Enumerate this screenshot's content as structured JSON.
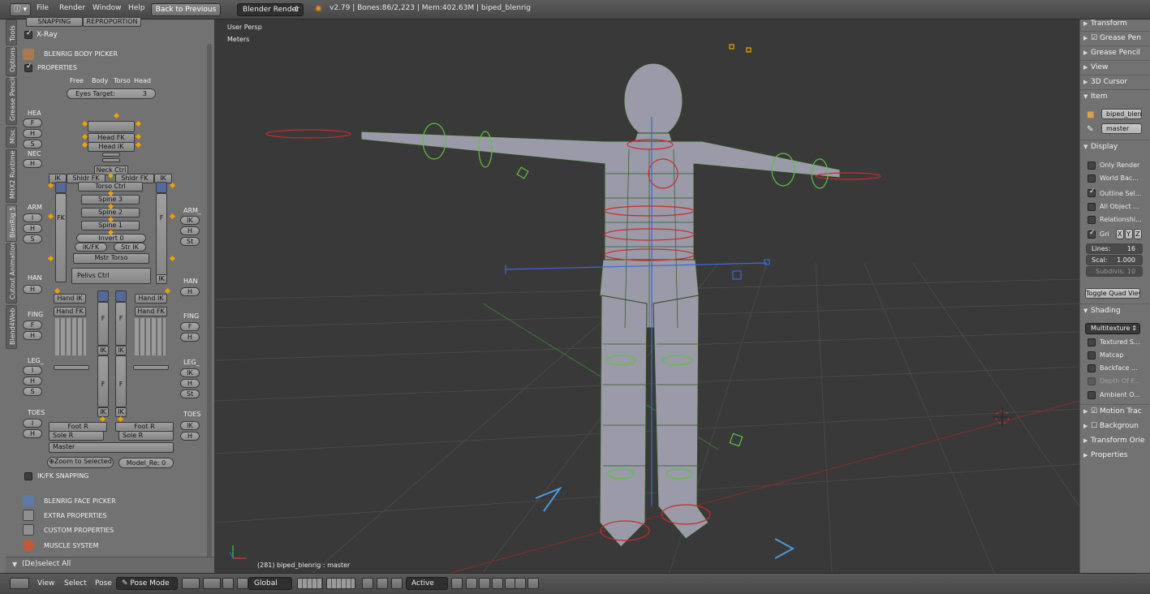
{
  "topbar": {
    "menus": [
      "File",
      "Render",
      "Window",
      "Help"
    ],
    "back_button": "Back to Previous",
    "engine": "Blender Render",
    "status": "v2.79 | Bones:86/2,223 | Mem:402.63M | biped_blenrig"
  },
  "left_tabs": [
    "Tools",
    "Options",
    "Grease Pencil",
    "Misc",
    "MHX2 Runtime",
    "BlenRig 5",
    "Cutout Animation",
    "Blend4Web"
  ],
  "tool_panel": {
    "snapping": "SNAPPING",
    "reproportion": "REPROPORTION",
    "xray": "X-Ray",
    "body_picker": "BLENRIG BODY PICKER",
    "properties": "PROPERTIES",
    "mode_labels": [
      "Free",
      "Body",
      "Torso",
      "Head"
    ],
    "eyes_target_label": "Eyes Target:",
    "eyes_target_value": "3",
    "head_label": "HEA",
    "neck_label": "NEC",
    "arm_l": "ARM",
    "arm_r": "ARM_",
    "hand_l": "HAN",
    "hand_r": "HAN",
    "fing_l": "FING",
    "fing_r": "FING",
    "leg_l": "LEG_",
    "leg_r": "LEG_",
    "toes_l": "TOES",
    "toes_r": "TOES",
    "fhs": [
      "F",
      "H",
      "S"
    ],
    "ih s": "",
    "head_fk": "Head FK",
    "head_ik": "Head IK",
    "neck_ctrl": "Neck Ctrl",
    "shldr_fk": "Shldr FK",
    "ik": "IK",
    "fk": "FK",
    "f": "F",
    "torso_ctrl": "Torso Ctrl",
    "spine3": "Spine 3",
    "spine2": "Spine 2",
    "spine1": "Spine 1",
    "invert": "Invert 0",
    "ikfk": "IK/FK",
    "str_ik": "Str IK",
    "mstr_torso": "Mstr Torso",
    "pelvis_ctrl": "Pelivs Ctrl",
    "hand_ik": "Hand IK",
    "hand_fk": "Hand FK",
    "foot_r": "Foot R",
    "sole_r": "Sole R",
    "master": "Master",
    "zoom_selected": "Zoom to Selected",
    "model_res": "Model_Re: 0",
    "ikfk_snapping": "IK/FK SNAPPING",
    "face_picker": "BLENRIG FACE PICKER",
    "extra_props": "EXTRA PROPERTIES",
    "custom_props": "CUSTOM PROPERTIES",
    "muscle": "MUSCLE SYSTEM",
    "ihst": [
      "I",
      "H",
      "S"
    ],
    "ik_h_st": [
      "IK",
      "H",
      "St"
    ],
    "fh": [
      "F",
      "H"
    ]
  },
  "op_panel": "(De)select All",
  "viewport": {
    "persp": "User Persp",
    "units": "Meters",
    "info": "(281) biped_blenrig : master"
  },
  "properties": {
    "transform": "Transform",
    "grease_panel": "Grease Pen",
    "grease_pencil": "Grease Pencil",
    "view": "View",
    "cursor": "3D Cursor",
    "item": "Item",
    "item_object": "biped_blen",
    "item_bone": "master",
    "display": "Display",
    "only_render": "Only Render",
    "world_bg": "World Bac...",
    "outline_sel": "Outline Sel...",
    "all_object": "All Object ...",
    "relationship": "Relationshi...",
    "grid": "Gri",
    "axes": [
      "X",
      "Y",
      "Z"
    ],
    "lines": "Lines:",
    "lines_val": "16",
    "scale": "Scal:",
    "scale_val": "1.000",
    "subdiv": "Subdivis: 10",
    "toggle_quad": "Toggle Quad View",
    "shading": "Shading",
    "shading_mode": "Multitexture",
    "textured": "Textured S...",
    "matcap": "Matcap",
    "backface": "Backface ...",
    "depth": "Depth Of F...",
    "ambient": "Ambient O...",
    "motion": "Motion Trac",
    "background": "Backgroun",
    "orient": "Transform Orie",
    "props": "Properties"
  },
  "bottombar": {
    "view": "View",
    "select": "Select",
    "pose": "Pose",
    "mode": "Pose Mode",
    "orientation": "Global",
    "pivot": "Active"
  }
}
